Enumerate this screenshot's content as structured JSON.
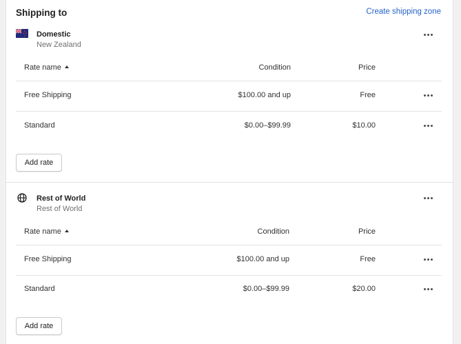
{
  "header": {
    "title": "Shipping to",
    "link": "Create shipping zone"
  },
  "columns": {
    "rate_name": "Rate name",
    "condition": "Condition",
    "price": "Price"
  },
  "zones": [
    {
      "name": "Domestic",
      "subtitle": "New Zealand",
      "icon": "new-zealand-flag-icon",
      "rates": [
        {
          "name": "Free Shipping",
          "condition": "$100.00 and up",
          "price": "Free"
        },
        {
          "name": "Standard",
          "condition": "$0.00–$99.99",
          "price": "$10.00"
        }
      ],
      "add_label": "Add rate"
    },
    {
      "name": "Rest of World",
      "subtitle": "Rest of World",
      "icon": "globe-icon",
      "rates": [
        {
          "name": "Free Shipping",
          "condition": "$100.00 and up",
          "price": "Free"
        },
        {
          "name": "Standard",
          "condition": "$0.00–$99.99",
          "price": "$20.00"
        }
      ],
      "add_label": "Add rate"
    }
  ],
  "colors": {
    "link": "#2463c9",
    "border": "#e3e3e3",
    "muted": "#707070"
  }
}
